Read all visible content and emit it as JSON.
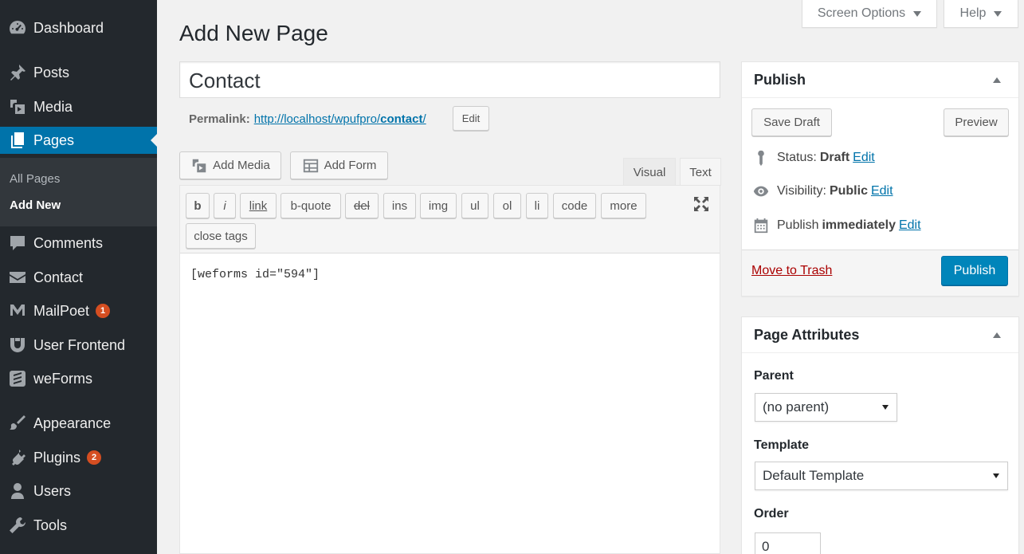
{
  "sidebar": {
    "items": [
      {
        "label": "Dashboard",
        "icon": "dashboard-icon"
      },
      {
        "label": "Posts",
        "icon": "pin-icon"
      },
      {
        "label": "Media",
        "icon": "media-icon"
      },
      {
        "label": "Pages",
        "icon": "pages-icon"
      },
      {
        "label": "Comments",
        "icon": "comment-icon"
      },
      {
        "label": "Contact",
        "icon": "envelope-icon"
      },
      {
        "label": "MailPoet",
        "icon": "mailpoet-icon",
        "badge": "1"
      },
      {
        "label": "User Frontend",
        "icon": "user-frontend-icon"
      },
      {
        "label": "weForms",
        "icon": "weforms-icon"
      },
      {
        "label": "Appearance",
        "icon": "brush-icon"
      },
      {
        "label": "Plugins",
        "icon": "plugin-icon",
        "badge": "2"
      },
      {
        "label": "Users",
        "icon": "users-icon"
      },
      {
        "label": "Tools",
        "icon": "wrench-icon"
      }
    ],
    "submenu": [
      {
        "label": "All Pages"
      },
      {
        "label": "Add New"
      }
    ]
  },
  "screen_meta": {
    "screen_options": "Screen Options",
    "help": "Help"
  },
  "page": {
    "title": "Add New Page",
    "post_title": "Contact"
  },
  "permalink": {
    "label": "Permalink:",
    "url_base": "http://localhost/wpufpro/",
    "slug": "contact",
    "url_end": "/",
    "edit": "Edit"
  },
  "media_buttons": {
    "add_media": "Add Media",
    "add_form": "Add Form"
  },
  "editor": {
    "tab_visual": "Visual",
    "tab_text": "Text",
    "quicktags": [
      "b",
      "i",
      "link",
      "b-quote",
      "del",
      "ins",
      "img",
      "ul",
      "ol",
      "li",
      "code",
      "more",
      "close tags"
    ],
    "content": "[weforms id=\"594\"]"
  },
  "publish": {
    "title": "Publish",
    "save_draft": "Save Draft",
    "preview": "Preview",
    "status_label": "Status:",
    "status_value": "Draft",
    "visibility_label": "Visibility:",
    "visibility_value": "Public",
    "schedule_label": "Publish",
    "schedule_value": "immediately",
    "edit": "Edit",
    "trash": "Move to Trash",
    "publish_btn": "Publish"
  },
  "page_attributes": {
    "title": "Page Attributes",
    "parent_label": "Parent",
    "parent_value": "(no parent)",
    "template_label": "Template",
    "template_value": "Default Template",
    "order_label": "Order",
    "order_value": "0"
  },
  "colors": {
    "sidebar_bg": "#23282d",
    "accent": "#0073aa",
    "publish_btn": "#0085ba",
    "trash": "#aa0000",
    "badge": "#d54e21"
  }
}
